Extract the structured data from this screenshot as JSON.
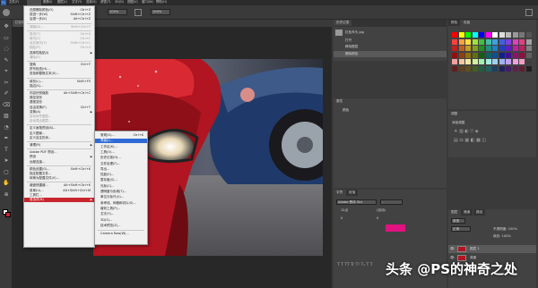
{
  "menubar": {
    "logo": "Ps",
    "items": [
      "文件(F)",
      "编辑(E)",
      "图像(I)",
      "图层(L)",
      "文字(Y)",
      "选择(S)",
      "滤镜(T)",
      "3D(D)",
      "视图(V)",
      "窗口(W)",
      "帮助(H)"
    ]
  },
  "options": {
    "zoom1": "100%",
    "zoom2": "100%",
    "mode": "正常"
  },
  "doc_tab": "红色车头.jpg @ 66.7%(RGB/8)",
  "edit_menu": [
    {
      "label": "还原删除颜色(O)",
      "shortcut": "Ctrl+Z"
    },
    {
      "label": "前进一步(W)",
      "shortcut": "Shift+Ctrl+Z"
    },
    {
      "label": "后退一步(K)",
      "shortcut": "Alt+Ctrl+Z"
    },
    {
      "sep": true
    },
    {
      "label": "渐隐(D)...",
      "shortcut": "Shift+Ctrl+F",
      "dis": true
    },
    {
      "sep": true
    },
    {
      "label": "剪切(T)",
      "shortcut": "Ctrl+X",
      "dis": true
    },
    {
      "label": "拷贝(C)",
      "shortcut": "Ctrl+C",
      "dis": true
    },
    {
      "label": "合并拷贝(Y)",
      "shortcut": "Shift+Ctrl+C",
      "dis": true
    },
    {
      "label": "粘贴(P)",
      "shortcut": "Ctrl+V",
      "dis": true
    },
    {
      "label": "选择性粘贴(I)",
      "arrow": true
    },
    {
      "label": "清除(E)",
      "dis": true
    },
    {
      "sep": true
    },
    {
      "label": "搜索",
      "shortcut": "Ctrl+F"
    },
    {
      "label": "拼写检查(H)..."
    },
    {
      "label": "查找和替换文本(X)..."
    },
    {
      "sep": true
    },
    {
      "label": "填充(L)...",
      "shortcut": "Shift+F5"
    },
    {
      "label": "描边(S)..."
    },
    {
      "sep": true
    },
    {
      "label": "内容识别缩放",
      "shortcut": "Alt+Shift+Ctrl+C"
    },
    {
      "label": "操控变形"
    },
    {
      "label": "透视变形"
    },
    {
      "label": "自由变换(F)",
      "shortcut": "Ctrl+T"
    },
    {
      "label": "变换(A)",
      "arrow": true
    },
    {
      "label": "自动对齐图层...",
      "dis": true
    },
    {
      "label": "自动混合图层...",
      "dis": true
    },
    {
      "sep": true
    },
    {
      "label": "定义画笔预设(B)..."
    },
    {
      "label": "定义图案..."
    },
    {
      "label": "定义自定形状..."
    },
    {
      "sep": true
    },
    {
      "label": "清理(R)",
      "arrow": true
    },
    {
      "sep": true
    },
    {
      "label": "Adobe PDF 预设..."
    },
    {
      "label": "预设",
      "arrow": true
    },
    {
      "label": "远程连接..."
    },
    {
      "sep": true
    },
    {
      "label": "颜色设置(G)...",
      "shortcut": "Shift+Ctrl+K"
    },
    {
      "label": "指定配置文件..."
    },
    {
      "label": "转换为配置文件(V)..."
    },
    {
      "sep": true
    },
    {
      "label": "键盘快捷键...",
      "shortcut": "Alt+Shift+Ctrl+K"
    },
    {
      "label": "菜单(U)...",
      "shortcut": "Alt+Shift+Ctrl+M"
    },
    {
      "label": "工具栏..."
    },
    {
      "label": "首选项(N)",
      "arrow": true,
      "hl": true
    }
  ],
  "prefs_menu": [
    {
      "label": "常规(G)...",
      "shortcut": "Ctrl+K"
    },
    {
      "label": "界面(I)...",
      "hl": true
    },
    {
      "label": "工作区(K)..."
    },
    {
      "label": "工具(O)..."
    },
    {
      "label": "历史记录(H)..."
    },
    {
      "label": "文件处理(F)..."
    },
    {
      "label": "导出..."
    },
    {
      "label": "性能(E)..."
    },
    {
      "label": "暂存盘(S)..."
    },
    {
      "label": "光标(C)..."
    },
    {
      "label": "透明度与色域(T)..."
    },
    {
      "label": "单位与标尺(U)..."
    },
    {
      "label": "参考线、网格和切片(S)..."
    },
    {
      "label": "增效工具(P)..."
    },
    {
      "label": "文字(Y)..."
    },
    {
      "label": "3D(3)..."
    },
    {
      "label": "技术预览(Z)..."
    },
    {
      "sep": true
    },
    {
      "label": "Camera Raw(W)..."
    }
  ],
  "history": {
    "tab": "历史记录",
    "file": "红色车头.jpg",
    "items": [
      "打开",
      "移除图层",
      "删除颜色"
    ]
  },
  "swatches": {
    "tab1": "颜色",
    "tab2": "色板"
  },
  "adjust": {
    "tab": "调整",
    "label": "添加调整"
  },
  "properties": {
    "tab": "属性",
    "label": "颜色",
    "sublabel": "像素图层"
  },
  "layers": {
    "tab": "图层",
    "tab2": "通道",
    "tab3": "路径",
    "kind": "类型",
    "mode": "正常",
    "opacity": "不透明度: 100%",
    "fill": "填充: 100%",
    "items": [
      "图层 1",
      "背景"
    ]
  },
  "text_panel": {
    "tab": "字符",
    "tab2": "段落",
    "font": "Adobe 黑体 Std",
    "style": "-",
    "size": "12点",
    "leading": "(自动)",
    "va": "0",
    "tracking": "0"
  },
  "watermark": "头条 @PS的神奇之处",
  "colors": {
    "accent": "#2f6bd6",
    "brand_red": "#c8262f",
    "fg_color": "#e0127f"
  }
}
